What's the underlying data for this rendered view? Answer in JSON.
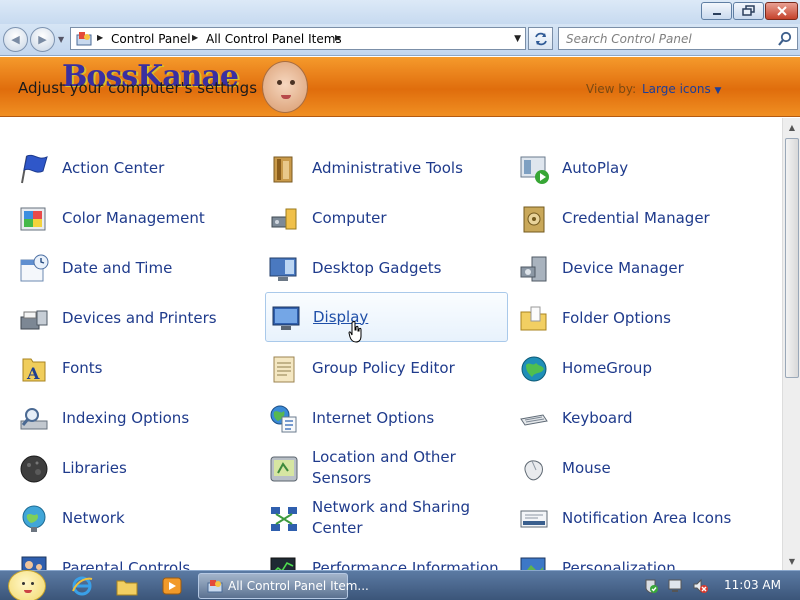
{
  "titlebar": {
    "minimize_icon": "minimize-icon",
    "maximize_icon": "maximize-icon",
    "close_icon": "close-icon"
  },
  "navbar": {
    "breadcrumb": [
      "Control Panel",
      "All Control Panel Items"
    ],
    "search_placeholder": "Search Control Panel"
  },
  "banner": {
    "logo_text": "BossKanae",
    "subtitle": "Adjust your computer's settings",
    "view_by_label": "View by:",
    "view_by_value": "Large icons"
  },
  "items": [
    {
      "label": "Action Center",
      "icon": "flag-icon"
    },
    {
      "label": "Administrative Tools",
      "icon": "admin-tools-icon"
    },
    {
      "label": "AutoPlay",
      "icon": "autoplay-icon"
    },
    {
      "label": "Color Management",
      "icon": "color-management-icon"
    },
    {
      "label": "Computer",
      "icon": "computer-icon"
    },
    {
      "label": "Credential Manager",
      "icon": "vault-icon"
    },
    {
      "label": "Date and Time",
      "icon": "calendar-clock-icon"
    },
    {
      "label": "Desktop Gadgets",
      "icon": "gadgets-icon"
    },
    {
      "label": "Device Manager",
      "icon": "device-manager-icon"
    },
    {
      "label": "Devices and Printers",
      "icon": "printer-icon"
    },
    {
      "label": "Display",
      "icon": "monitor-icon"
    },
    {
      "label": "Folder Options",
      "icon": "folder-icon"
    },
    {
      "label": "Fonts",
      "icon": "fonts-icon"
    },
    {
      "label": "Group Policy Editor",
      "icon": "scroll-icon"
    },
    {
      "label": "HomeGroup",
      "icon": "homegroup-icon"
    },
    {
      "label": "Indexing Options",
      "icon": "indexing-icon"
    },
    {
      "label": "Internet Options",
      "icon": "globe-icon"
    },
    {
      "label": "Keyboard",
      "icon": "keyboard-icon"
    },
    {
      "label": "Libraries",
      "icon": "libraries-icon"
    },
    {
      "label": "Location and Other Sensors",
      "icon": "sensor-icon"
    },
    {
      "label": "Mouse",
      "icon": "mouse-icon"
    },
    {
      "label": "Network",
      "icon": "network-icon"
    },
    {
      "label": "Network and Sharing Center",
      "icon": "network-sharing-icon"
    },
    {
      "label": "Notification Area Icons",
      "icon": "notification-icon"
    },
    {
      "label": "Parental Controls",
      "icon": "parental-icon"
    },
    {
      "label": "Performance Information",
      "icon": "performance-icon"
    },
    {
      "label": "Personalization",
      "icon": "personalization-icon"
    }
  ],
  "taskbar": {
    "task_label": "All Control Panel Item...",
    "clock": "11:03 AM"
  }
}
